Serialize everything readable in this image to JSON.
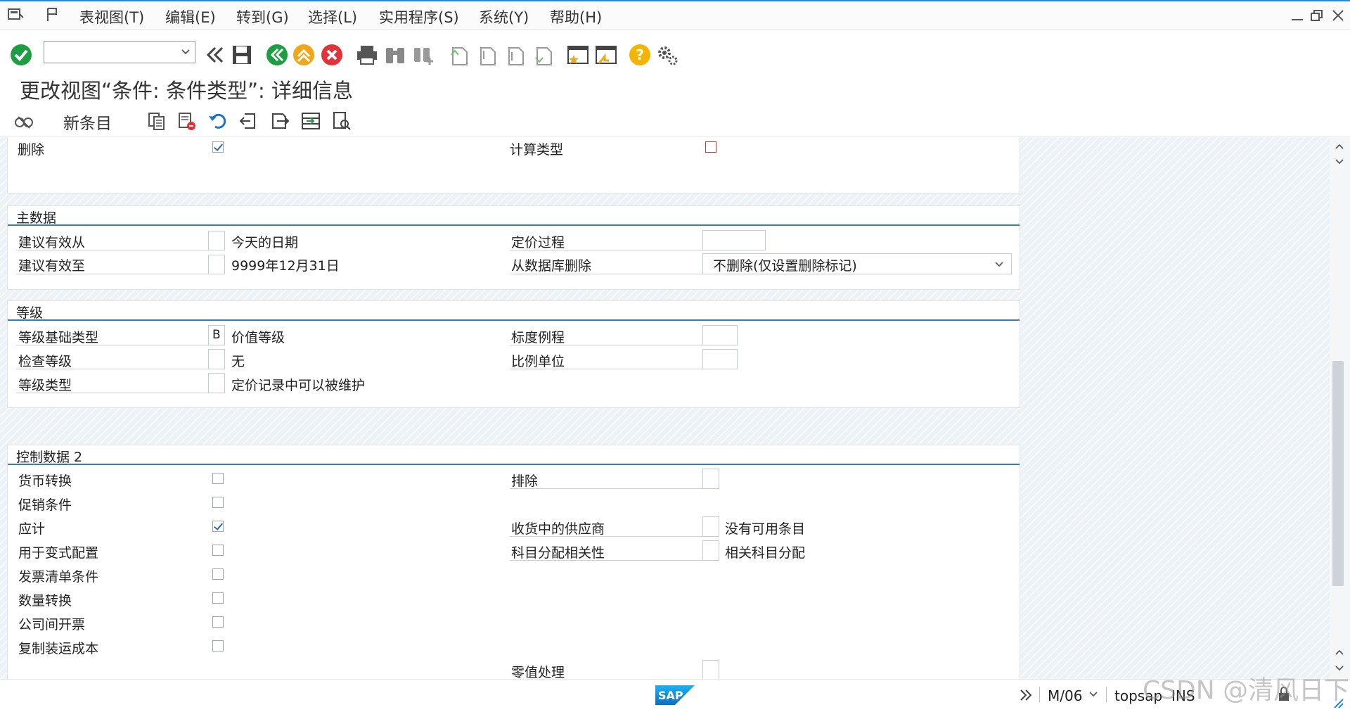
{
  "menubar": {
    "items": [
      {
        "label": "表视图(T)"
      },
      {
        "label": "编辑(E)"
      },
      {
        "label": "转到(G)"
      },
      {
        "label": "选择(L)"
      },
      {
        "label": "实用程序(S)"
      },
      {
        "label": "系统(Y)"
      },
      {
        "label": "帮助(H)"
      }
    ]
  },
  "toolbar": {
    "command_value": ""
  },
  "title": "更改视图“条件: 条件类型”: 详细信息",
  "app_toolbar": {
    "new_entries_label": "新条目"
  },
  "top_fragment": {
    "delete_label": "删除",
    "delete_checked": true,
    "calc_type_label": "计算类型",
    "calc_type_checked": false
  },
  "master_data": {
    "heading": "主数据",
    "valid_from_label": "建议有效从",
    "valid_from_value": "",
    "valid_from_text": "今天的日期",
    "valid_to_label": "建议有效至",
    "valid_to_value": "",
    "valid_to_text": "9999年12月31日",
    "pricing_proc_label": "定价过程",
    "pricing_proc_value": "",
    "delete_db_label": "从数据库删除",
    "delete_db_value": "不删除(仅设置删除标记)"
  },
  "scales": {
    "heading": "等级",
    "basis_type_label": "等级基础类型",
    "basis_type_value": "B",
    "basis_type_text": "价值等级",
    "check_label": "检查等级",
    "check_value": "",
    "check_text": "无",
    "scale_type_label": "等级类型",
    "scale_type_value": "",
    "scale_type_text": "定价记录中可以被维护",
    "formula_label": "标度例程",
    "formula_value": "",
    "unit_label": "比例单位",
    "unit_value": ""
  },
  "control2": {
    "heading": "控制数据 2",
    "left_items": [
      {
        "label": "货币转换",
        "checked": false
      },
      {
        "label": "促销条件",
        "checked": false
      },
      {
        "label": "应计",
        "checked": true
      },
      {
        "label": "用于变式配置",
        "checked": false
      },
      {
        "label": "发票清单条件",
        "checked": false
      },
      {
        "label": "数量转换",
        "checked": false
      },
      {
        "label": "公司间开票",
        "checked": false
      },
      {
        "label": "复制装运成本",
        "checked": false
      }
    ],
    "exclusion_label": "排除",
    "exclusion_value": "",
    "vendor_gr_label": "收货中的供应商",
    "vendor_gr_value": "",
    "vendor_gr_text": "没有可用条目",
    "acct_assign_label": "科目分配相关性",
    "acct_assign_value": "",
    "acct_assign_text": "相关科目分配",
    "zero_label": "零值处理",
    "zero_value": ""
  },
  "statusbar": {
    "transaction": "M/06",
    "user": "topsap",
    "mode": "INS",
    "watermark": "CSDN @清风日下"
  },
  "colors": {
    "accent_blue": "#2e7fc1",
    "ok_green": "#1e9e43",
    "cancel_red": "#e0343a",
    "exit_orange": "#f0a71a",
    "help_yellow": "#f4b400"
  }
}
